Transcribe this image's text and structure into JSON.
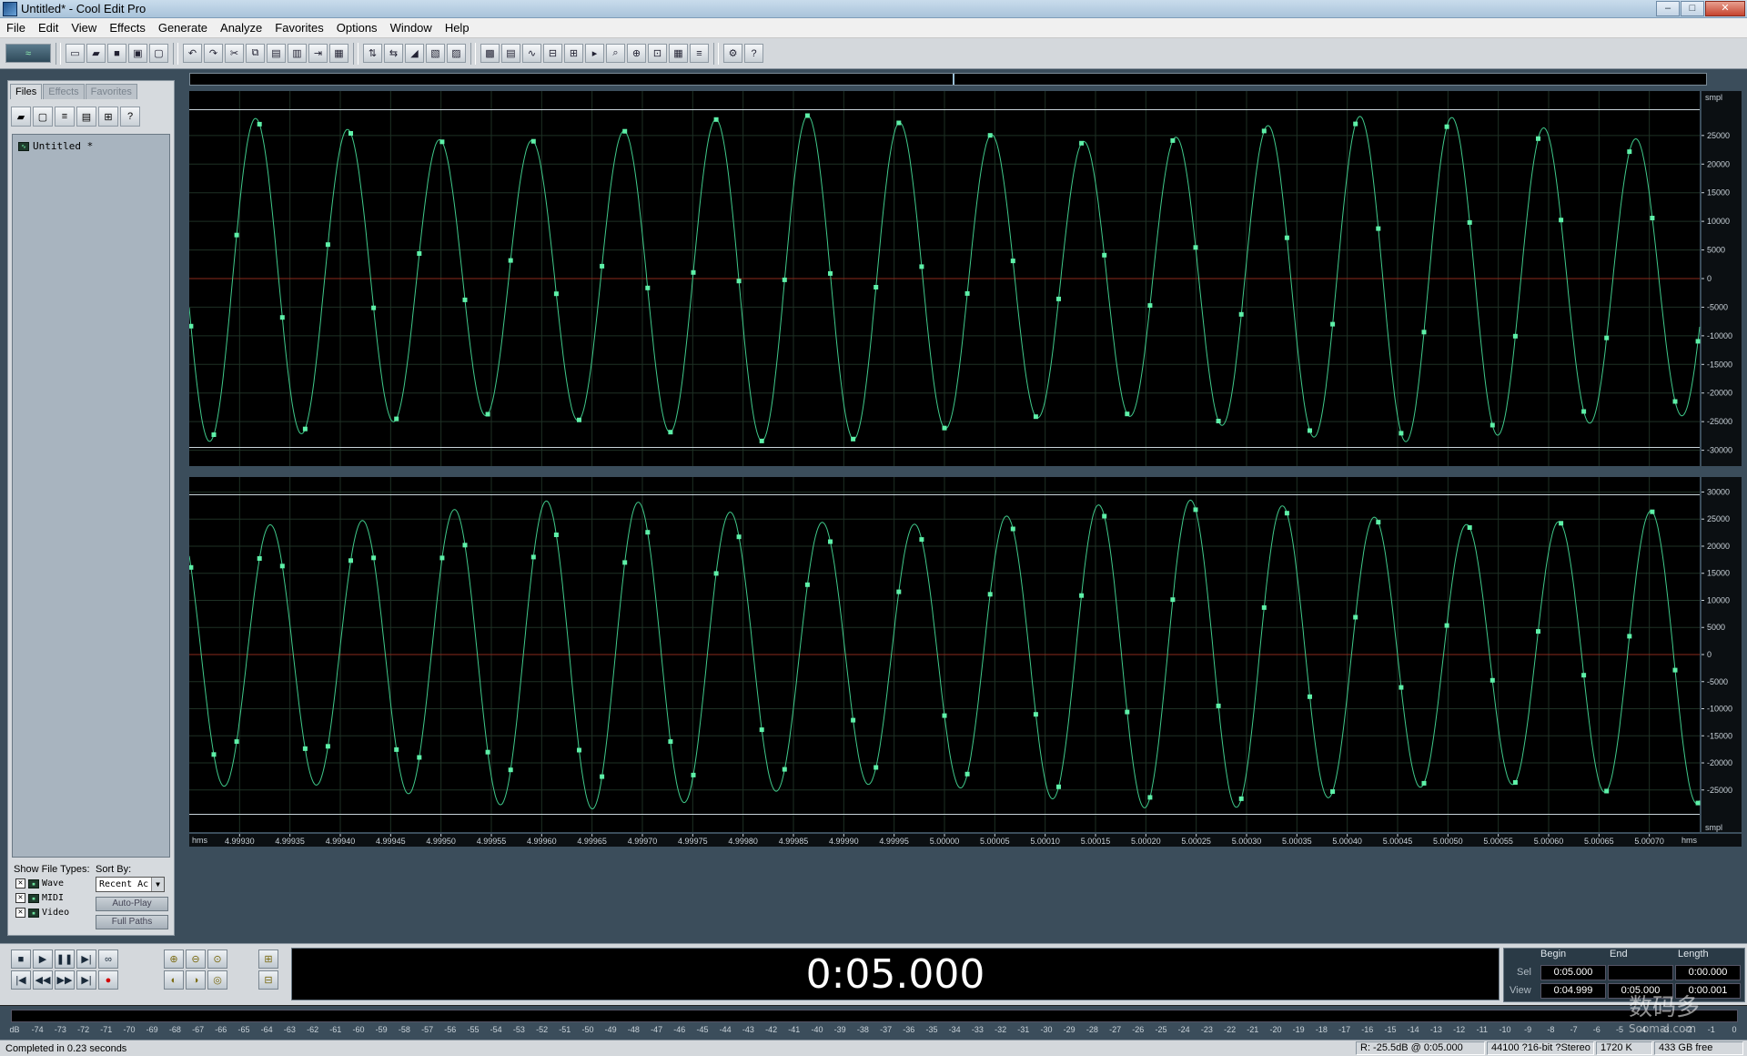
{
  "window": {
    "title": "Untitled* - Cool Edit Pro",
    "controls": {
      "minimize": "–",
      "maximize": "□",
      "close": "✕"
    }
  },
  "menu": [
    "File",
    "Edit",
    "View",
    "Effects",
    "Generate",
    "Analyze",
    "Favorites",
    "Options",
    "Window",
    "Help"
  ],
  "toolbar": {
    "icons": [
      "waveform-multitrack-toggle-icon",
      "new-file-icon",
      "open-file-icon",
      "save-icon",
      "save-as-icon",
      "close-file-icon",
      "undo-icon",
      "redo-icon",
      "cut-icon",
      "copy-icon",
      "paste-icon",
      "mix-paste-icon",
      "trim-icon",
      "silence-icon",
      "invert-icon",
      "reverse-icon",
      "amplify-icon",
      "normalize-icon",
      "envelope-icon",
      "noise-reduction-icon",
      "spectral-view-icon",
      "waveform-view-icon",
      "snap-icon",
      "loop-icon",
      "cue-icon",
      "zoom-region-icon",
      "marker-icon",
      "sync-icon",
      "batch-icon",
      "script-icon",
      "properties-icon",
      "help-icon"
    ]
  },
  "left_panel": {
    "tabs": [
      {
        "label": "Files",
        "active": true
      },
      {
        "label": "Effects",
        "active": false
      },
      {
        "label": "Favorites",
        "active": false
      }
    ],
    "tool_icons": [
      "open-folder-icon",
      "close-icon",
      "list-icon",
      "properties-icon",
      "insert-icon",
      "help-icon"
    ],
    "files": [
      {
        "name": "Untitled *"
      }
    ],
    "show_file_types_label": "Show File Types:",
    "sort_by_label": "Sort By:",
    "file_types": [
      {
        "label": "Wave",
        "checked": true
      },
      {
        "label": "MIDI",
        "checked": true
      },
      {
        "label": "Video",
        "checked": true
      }
    ],
    "sort_value": "Recent Ac",
    "auto_play": "Auto-Play",
    "full_paths": "Full Paths"
  },
  "wave": {
    "sample_rate": 44100,
    "view_start_s": 4.99925,
    "view_end_s": 5.00075,
    "upper_ruler": {
      "unit": "smpl",
      "ticks": [
        25000,
        20000,
        15000,
        10000,
        5000,
        0,
        -5000,
        -10000,
        -15000,
        -20000,
        -25000,
        -30000
      ]
    },
    "lower_ruler": {
      "unit": "smpl",
      "ticks": [
        30000,
        25000,
        20000,
        15000,
        10000,
        5000,
        0,
        -5000,
        -10000,
        -15000,
        -20000,
        -25000
      ]
    },
    "time_ruler": {
      "unit": "hms",
      "ticks": [
        "4.99930",
        "4.99935",
        "4.99940",
        "4.99945",
        "4.99950",
        "4.99955",
        "4.99960",
        "4.99965",
        "4.99970",
        "4.99975",
        "4.99980",
        "4.99985",
        "4.99990",
        "4.99995",
        "5.00000",
        "5.00005",
        "5.00010",
        "5.00015",
        "5.00020",
        "5.00025",
        "5.00030",
        "5.00035",
        "5.00040",
        "5.00045",
        "5.00050",
        "5.00055",
        "5.00060",
        "5.00065",
        "5.00070"
      ]
    },
    "colors": {
      "background": "#000000",
      "waveform": "#3fc98a",
      "sample_points": "#5ef0a8",
      "center_line": "#8a2a1c",
      "grid": "#1e3024",
      "limit_line": "#c9d4da"
    }
  },
  "transport": {
    "row1": [
      "stop-icon",
      "play-icon",
      "pause-icon",
      "play-to-end-icon",
      "loop-play-icon"
    ],
    "row2": [
      "go-to-start-icon",
      "rewind-icon",
      "fast-forward-icon",
      "go-to-end-icon",
      "record-icon"
    ],
    "zoom_row1": [
      "zoom-in-horizontal-icon",
      "zoom-out-horizontal-icon",
      "zoom-full-icon",
      "zoom-in-vertical-icon"
    ],
    "zoom_row2": [
      "zoom-to-left-icon",
      "zoom-to-right-icon",
      "zoom-selection-icon",
      "zoom-out-vertical-icon"
    ]
  },
  "time_display": "0:05.000",
  "selection": {
    "headers": {
      "begin": "Begin",
      "end": "End",
      "length": "Length"
    },
    "sel": {
      "label": "Sel",
      "begin": "0:05.000",
      "end": "",
      "length": "0:00.000"
    },
    "view": {
      "label": "View",
      "begin": "0:04.999",
      "end": "0:05.000",
      "length": "0:00.001"
    }
  },
  "meter": {
    "ticks": [
      "dB",
      "-74",
      "-73",
      "-72",
      "-71",
      "-70",
      "-69",
      "-68",
      "-67",
      "-66",
      "-65",
      "-64",
      "-63",
      "-62",
      "-61",
      "-60",
      "-59",
      "-58",
      "-57",
      "-56",
      "-55",
      "-54",
      "-53",
      "-52",
      "-51",
      "-50",
      "-49",
      "-48",
      "-47",
      "-46",
      "-45",
      "-44",
      "-43",
      "-42",
      "-41",
      "-40",
      "-39",
      "-38",
      "-37",
      "-36",
      "-35",
      "-34",
      "-33",
      "-32",
      "-31",
      "-30",
      "-29",
      "-28",
      "-27",
      "-26",
      "-25",
      "-24",
      "-23",
      "-22",
      "-21",
      "-20",
      "-19",
      "-18",
      "-17",
      "-16",
      "-15",
      "-14",
      "-13",
      "-12",
      "-11",
      "-10",
      "-9",
      "-8",
      "-7",
      "-6",
      "-5",
      "-4",
      "-3",
      "-2",
      "-1",
      "0"
    ]
  },
  "status": {
    "message": "Completed in 0.23 seconds",
    "level": "R: -25.5dB @ 0:05.000",
    "format": "44100 ?16-bit ?Stereo",
    "size": "1720 K",
    "free": "433 GB free"
  },
  "watermark": {
    "main": "数码多",
    "sub": "Soomal.com"
  }
}
